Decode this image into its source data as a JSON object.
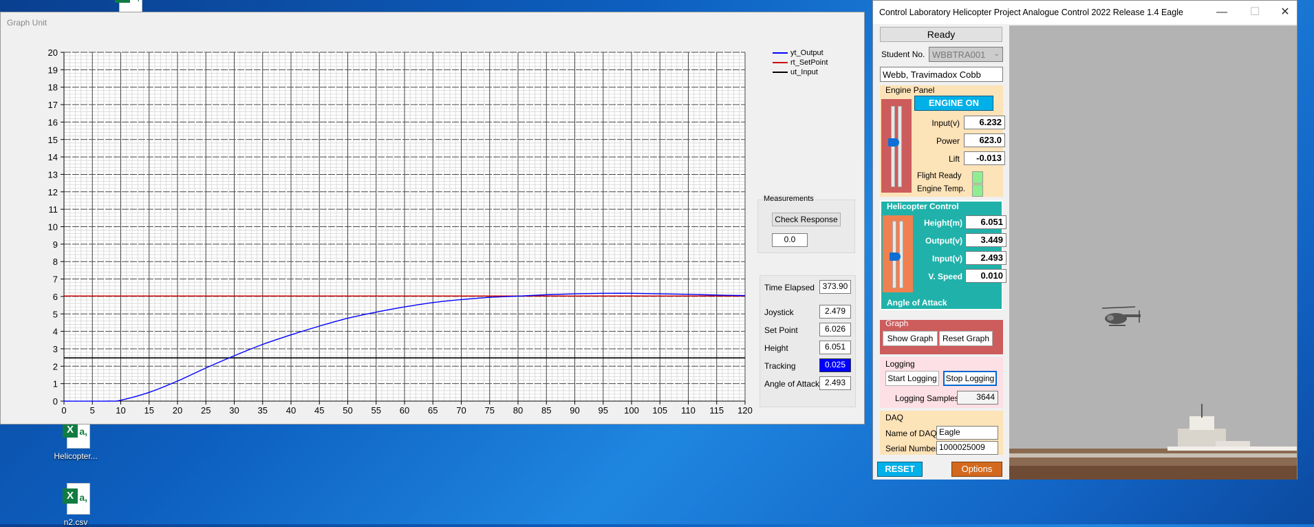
{
  "desktop": {
    "icons": [
      {
        "label": "Helicopter...",
        "glyph": "a,"
      },
      {
        "label": "n2.csv",
        "glyph": "a,"
      }
    ]
  },
  "graph_window": {
    "title": "Graph Unit",
    "measurements": {
      "group_label": "Measurements",
      "check_button": "Check Response",
      "value": "0.0"
    },
    "readouts": [
      {
        "label": "Time Elapsed",
        "value": "373.90"
      },
      {
        "label": "Joystick",
        "value": "2.479"
      },
      {
        "label": "Set Point",
        "value": "6.026"
      },
      {
        "label": "Height",
        "value": "6.051"
      },
      {
        "label": "Tracking",
        "value": "0.025"
      },
      {
        "label": "Angle of Attack",
        "value": "2.493"
      }
    ]
  },
  "chart_data": {
    "type": "line",
    "title": "",
    "xlabel": "",
    "ylabel": "",
    "xlim": [
      0,
      120
    ],
    "ylim": [
      0,
      20
    ],
    "x_ticks": [
      0,
      5,
      10,
      15,
      20,
      25,
      30,
      35,
      40,
      45,
      50,
      55,
      60,
      65,
      70,
      75,
      80,
      85,
      90,
      95,
      100,
      105,
      110,
      115,
      120
    ],
    "y_ticks": [
      0,
      1,
      2,
      3,
      4,
      5,
      6,
      7,
      8,
      9,
      10,
      11,
      12,
      13,
      14,
      15,
      16,
      17,
      18,
      19,
      20
    ],
    "grid": true,
    "legend_position": "top-right",
    "series": [
      {
        "name": "yt_Output",
        "color": "#0000ff",
        "x": [
          0,
          8,
          10,
          15,
          20,
          25,
          30,
          35,
          40,
          45,
          50,
          55,
          60,
          65,
          70,
          75,
          80,
          85,
          90,
          95,
          100,
          105,
          110,
          115,
          120
        ],
        "y": [
          0,
          0,
          0.05,
          0.5,
          1.15,
          1.9,
          2.6,
          3.25,
          3.8,
          4.3,
          4.75,
          5.1,
          5.4,
          5.65,
          5.82,
          5.95,
          6.02,
          6.1,
          6.15,
          6.18,
          6.18,
          6.15,
          6.12,
          6.08,
          6.05
        ]
      },
      {
        "name": "rt_SetPoint",
        "color": "#cc0000",
        "x": [
          0,
          120
        ],
        "y": [
          6.026,
          6.026
        ]
      },
      {
        "name": "ut_Input",
        "color": "#000000",
        "x": [
          0,
          120
        ],
        "y": [
          2.479,
          2.479
        ]
      }
    ]
  },
  "control_window": {
    "title": "Control Laboratory Helicopter Project Analogue Control 2022 Release 1.4 Eagle",
    "status_button": "Ready",
    "student_label": "Student No.",
    "student_no": "WBBTRA001",
    "student_name": "Webb, Travimadox Cobb",
    "engine_panel": {
      "label": "Engine Panel",
      "engine_button": "ENGINE ON",
      "slider_level": 0.55,
      "fields": [
        {
          "label": "Input(v)",
          "value": "6.232"
        },
        {
          "label": "Power",
          "value": "623.0"
        },
        {
          "label": "Lift",
          "value": "-0.013"
        }
      ],
      "flight_ready": "Flight Ready",
      "engine_temp": "Engine Temp."
    },
    "heli_control": {
      "label": "Helicopter Control",
      "slider_level": 0.45,
      "fields": [
        {
          "label": "Height(m)",
          "value": "6.051"
        },
        {
          "label": "Output(v)",
          "value": "3.449"
        },
        {
          "label": "Input(v)",
          "value": "2.493"
        },
        {
          "label": "V. Speed",
          "value": "0.010"
        }
      ],
      "angle_label": "Angle of Attack"
    },
    "graph_panel": {
      "label": "Graph",
      "show": "Show Graph",
      "reset": "Reset Graph"
    },
    "logging_panel": {
      "label": "Logging",
      "start": "Start Logging",
      "stop": "Stop Logging",
      "samples_label": "Logging Samples",
      "samples": "3644"
    },
    "daq_panel": {
      "label": "DAQ",
      "name_label": "Name of DAQ",
      "name": "Eagle",
      "serial_label": "Serial Number",
      "serial": "1000025009"
    },
    "reset_button": "RESET",
    "options_button": "Options",
    "colors": {
      "engine_bg": "#fde3b8",
      "engine_slider_bg": "#cd5c5c",
      "engine_btn": "#00b0e8",
      "heli_bg": "#20b2aa",
      "heli_slider_bg": "#f08050",
      "graph_bg": "#cd5c5c",
      "logging_bg": "#fde0e6",
      "daq_bg": "#fde3b8",
      "reset_bg": "#00b0e8",
      "options_bg": "#d2691e",
      "indicator": "#90ee90"
    }
  }
}
